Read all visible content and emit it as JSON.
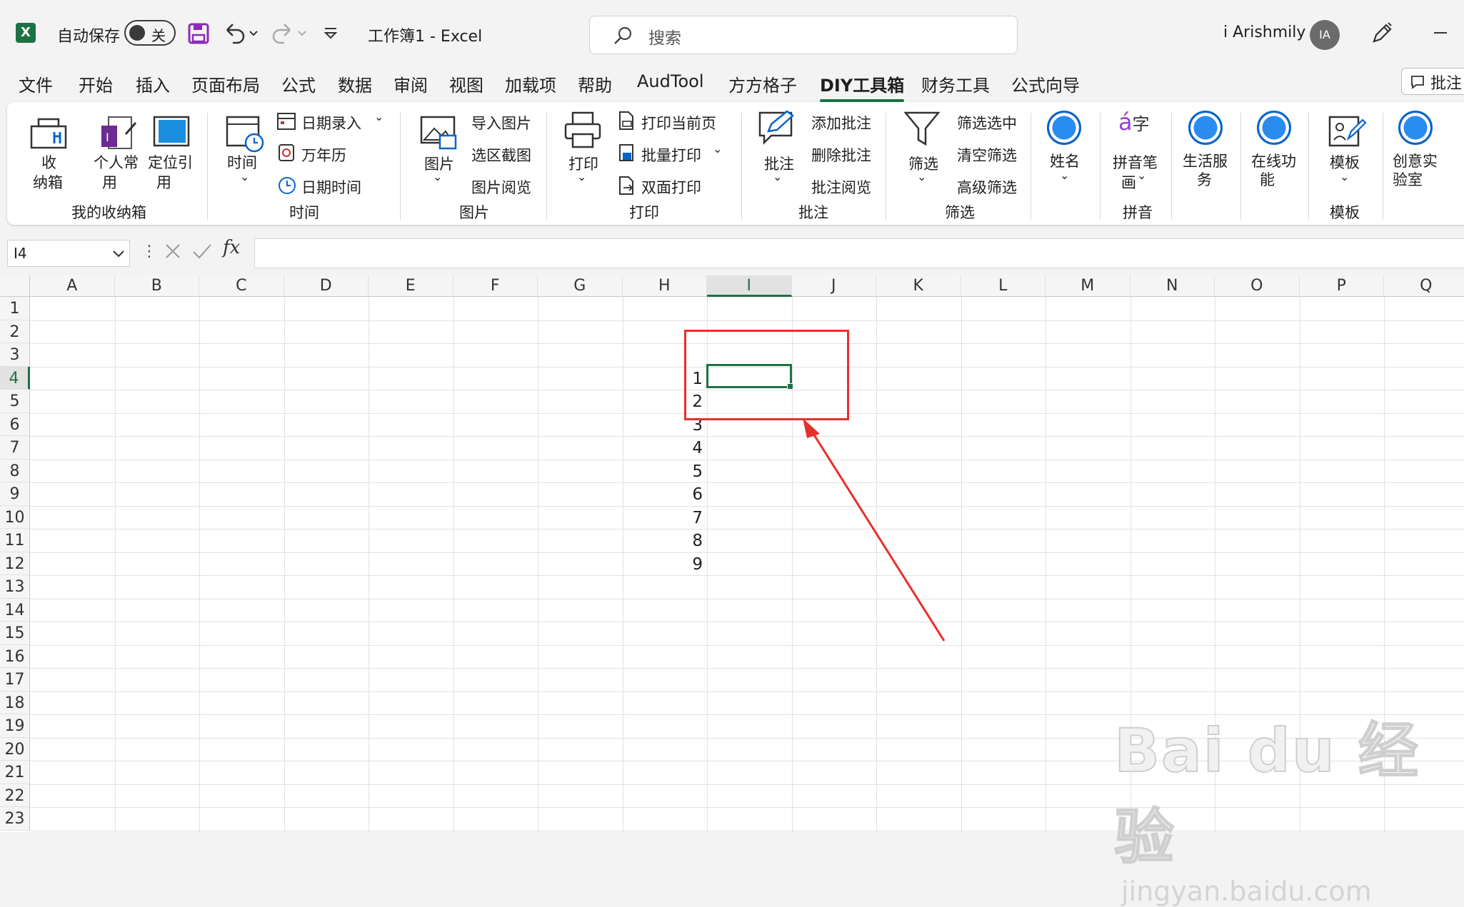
{
  "app": {
    "autosave_label": "自动保存",
    "autosave_state": "关",
    "title": "工作簿1  -  Excel",
    "search_placeholder": "搜索",
    "user_name": "i Arishmily",
    "user_initials": "IA",
    "comment_button": "批注"
  },
  "tabs": [
    "文件",
    "开始",
    "插入",
    "页面布局",
    "公式",
    "数据",
    "审阅",
    "视图",
    "加载项",
    "帮助",
    "AudTool",
    "方方格子",
    "DIY工具箱",
    "财务工具",
    "公式向导"
  ],
  "active_tab": "DIY工具箱",
  "ribbon": {
    "groups": {
      "storage": "我的收纳箱",
      "time": "时间",
      "picture": "图片",
      "print": "打印",
      "comment": "批注",
      "filter": "筛选",
      "pinyin": "拼音",
      "template": "模板"
    },
    "storage_box": [
      "收",
      "纳箱"
    ],
    "personal": [
      "个人常",
      "用"
    ],
    "locate": [
      "定位引",
      "用"
    ],
    "time_btn": "时间",
    "date_entry": "日期录入",
    "calendar": "万年历",
    "datetime": "日期时间",
    "picture_btn": "图片",
    "import_picture": "导入图片",
    "region_capture": "选区截图",
    "picture_view": "图片阅览",
    "print_btn": "打印",
    "print_current": "打印当前页",
    "batch_print": "批量打印",
    "duplex_print": "双面打印",
    "comment_btn": "批注",
    "add_comment": "添加批注",
    "delete_comment": "删除批注",
    "comment_view": "批注阅览",
    "filter_btn": "筛选",
    "filter_selected": "筛选选中",
    "clear_filter": "清空筛选",
    "advanced_filter": "高级筛选",
    "name_btn": "姓名",
    "pinyin_strokes": [
      "拼音笔",
      "画"
    ],
    "life_service": [
      "生活服",
      "务"
    ],
    "online_func": [
      "在线功",
      "能"
    ],
    "template_btn": "模板",
    "creative_lab": [
      "创意实",
      "验室"
    ]
  },
  "formula_bar": {
    "name_box": "I4",
    "fx": "fx",
    "content": ""
  },
  "sheet": {
    "columns": [
      "A",
      "B",
      "C",
      "D",
      "E",
      "F",
      "G",
      "H",
      "I",
      "J",
      "K",
      "L",
      "M",
      "N",
      "O",
      "P",
      "Q"
    ],
    "rows": [
      "1",
      "2",
      "3",
      "4",
      "5",
      "6",
      "7",
      "8",
      "9",
      "10",
      "11",
      "12",
      "13",
      "14",
      "15",
      "16",
      "17",
      "18",
      "19",
      "20",
      "21",
      "22",
      "23"
    ],
    "selected_cell": "I4",
    "selected_column": "I",
    "selected_row": "4",
    "column_h_values": [
      {
        "row": "4",
        "value": "1"
      },
      {
        "row": "5",
        "value": "2"
      },
      {
        "row": "6",
        "value": "3"
      },
      {
        "row": "7",
        "value": "4"
      },
      {
        "row": "8",
        "value": "5"
      },
      {
        "row": "9",
        "value": "6"
      },
      {
        "row": "10",
        "value": "7"
      },
      {
        "row": "11",
        "value": "8"
      },
      {
        "row": "12",
        "value": "9"
      }
    ]
  },
  "annotation_color": "#e8302b",
  "accent_color": "#1e7145",
  "watermark": {
    "logo": "Bai du 经验",
    "url": "jingyan.baidu.com"
  }
}
